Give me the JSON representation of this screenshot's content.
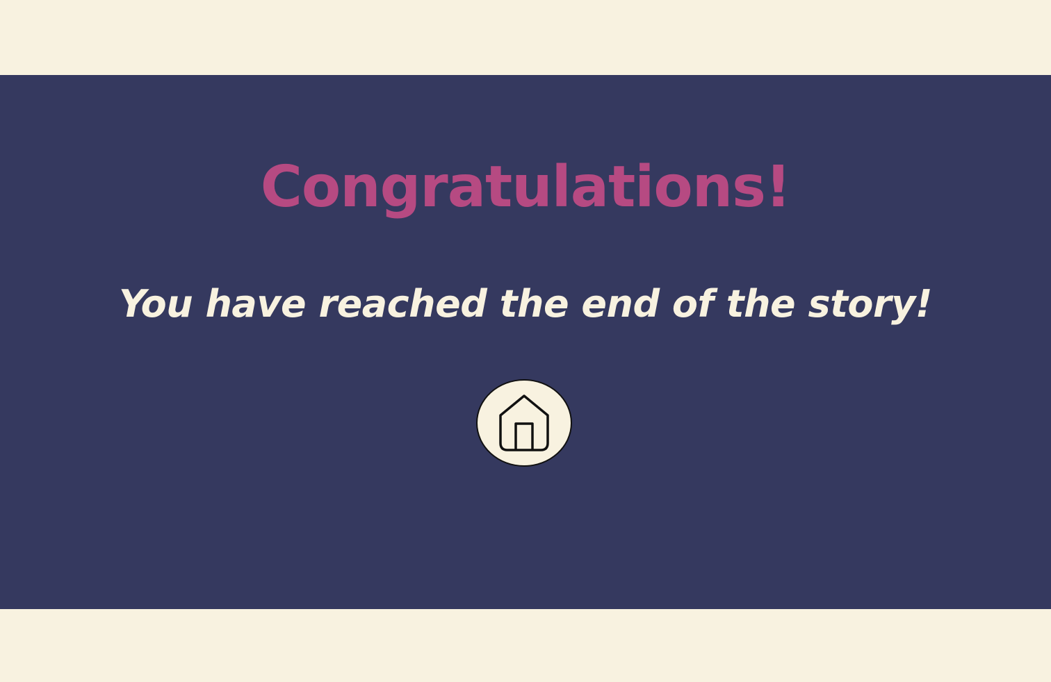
{
  "end_screen": {
    "title": "Congratulations!",
    "message": "You have reached the end of the story!",
    "home_button": {
      "icon": "home-icon"
    }
  },
  "colors": {
    "background_cream": "#f8f2e0",
    "panel_navy": "#35395f",
    "title_pink": "#b64a82",
    "text_cream": "#f8f2e0",
    "icon_stroke": "#111111"
  }
}
